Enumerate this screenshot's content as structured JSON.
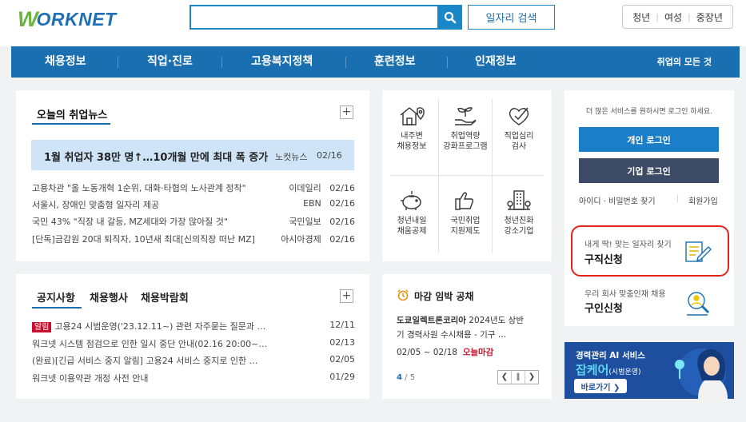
{
  "header": {
    "logo_w": "W",
    "logo_rest": "ORKNET",
    "search_placeholder": "",
    "job_search_label": "일자리 검색",
    "targets": [
      "청년",
      "여성",
      "중장년"
    ]
  },
  "gnb": {
    "items": [
      "채용정보",
      "직업·진로",
      "고용복지정책",
      "훈련정보",
      "인재정보"
    ],
    "all_label": "취업의 모든 것"
  },
  "news": {
    "title": "오늘의 취업뉴스",
    "featured": {
      "text": "1월 취업자 38만 명↑…10개월 만에 최대 폭 증가",
      "source": "노컷뉴스",
      "date": "02/16"
    },
    "items": [
      {
        "text": "고용차관 \"올 노동개혁 1순위, 대화·타협의 노사관계 정착\"",
        "source": "이데일리",
        "date": "02/16"
      },
      {
        "text": "서울시, 장애인 맞춤형 일자리 제공",
        "source": "EBN",
        "date": "02/16"
      },
      {
        "text": "국민 43% \"직장 내 갈등, MZ세대와 가장 많아질 것\"",
        "source": "국민일보",
        "date": "02/16"
      },
      {
        "text": "[단독]금감원 20대 퇴직자, 10년새 최대[신의직장 떠난 MZ]",
        "source": "아시아경제",
        "date": "02/16"
      }
    ]
  },
  "services": [
    {
      "line1": "내주변",
      "line2": "채용정보",
      "icon": "house-map-icon"
    },
    {
      "line1": "취업역량",
      "line2": "강화프로그램",
      "icon": "sprout-hand-icon"
    },
    {
      "line1": "직업심리",
      "line2": "검사",
      "icon": "heart-check-icon"
    },
    {
      "line1": "청년내일",
      "line2": "채움공제",
      "icon": "piggy-bank-icon"
    },
    {
      "line1": "국민취업",
      "line2": "지원제도",
      "icon": "thumbs-up-icon"
    },
    {
      "line1": "청년친화",
      "line2": "강소기업",
      "icon": "building-icon"
    }
  ],
  "login": {
    "notice": "더 많은 서비스를 원하시면 로그인 하세요.",
    "personal": "개인 로그인",
    "company": "기업 로그인",
    "find": "아이디 · 비밀번호 찾기",
    "join": "회원가입"
  },
  "job_seek": {
    "sub": "내게 딱! 맞는 일자리 찾기",
    "title": "구직신청"
  },
  "job_offer": {
    "sub": "우리 회사 맞춤인재 채용",
    "title": "구인신청"
  },
  "notice": {
    "tabs": [
      "공지사항",
      "채용행사",
      "채용박람회"
    ],
    "badge": "알림",
    "items": [
      {
        "text": "고용24 시범운영('23.12.11~) 관련 자주묻는 질문과 …",
        "date": "12/11"
      },
      {
        "text": "워크넷 시스템 점검으로 인한 일시 중단 안내(02.16 20:00~…",
        "date": "02/13"
      },
      {
        "text": "(완료)[긴급 서비스 중지 알림] 고용24 서비스 중지로 인한 …",
        "date": "02/05"
      },
      {
        "text": "워크넷 이용약관 개정 사전 안내",
        "date": "01/29"
      }
    ]
  },
  "deadline": {
    "title": "마감 임박 공채",
    "company": "도쿄일렉트론코리아",
    "desc1": " 2024년도 상반",
    "desc2": "기 경력사원 수시채용 - 기구 …",
    "period": "02/05 ~ 02/18",
    "today": "오늘마감",
    "page_current": "4",
    "page_total": " / 5"
  },
  "banner": {
    "line1": "경력관리 AI 서비스",
    "brand": "잡케어",
    "brand_sub": "(시범운영)",
    "cta": "바로가기 ❯"
  },
  "colors": {
    "primary": "#1a6fb0",
    "accent": "#1a87c9",
    "green": "#6cb33f",
    "red": "#c8102e",
    "navy": "#3d4a66"
  }
}
